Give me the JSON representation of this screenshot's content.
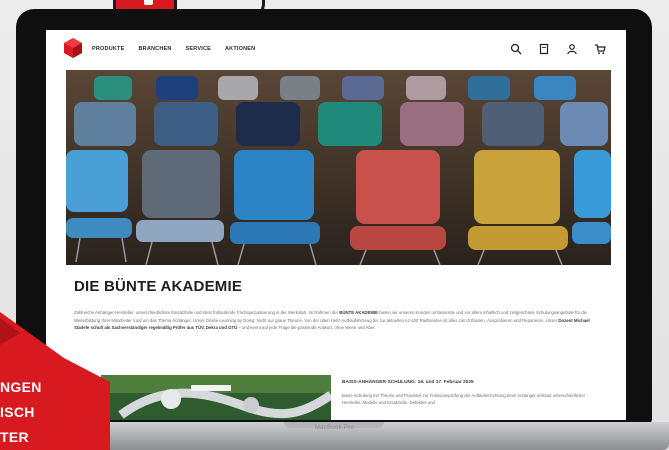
{
  "site": {
    "nav": [
      "PRODUKTE",
      "BRANCHEN",
      "SERVICE",
      "AKTIONEN"
    ]
  },
  "headline": "DIE BÜNTE AKADEMIE",
  "intro": {
    "part1": "Zahlreiche Anhänger-Hersteller, unterschiedlichste Einsatzfelle und stets fortlaufende Fachspezialisierung in der Werkstatt. Im Rahmen der ",
    "bold1": "BÜNTE AKADEMIE",
    "part2": " bieten wir unseren Kunden umfassende und vor allem inhaltlich und zielgerichtete Schulungsangebote für die Weiterbildung Ihrer Mitarbeiter rund um das Thema Anhänger. Unser Onsite-Learning by Doing: Nicht nur graue Theorie, Von der alten Heliz Aufbaufahrzeug bis zur aktuellen Az-400 Radbremse ist alles zum Erfassen, Ausprobieren und Reparieren. Unser ",
    "bold2": "Dozent Michael Stadele",
    "part3": " ",
    "bold3": "schult als Sachverständiger regelmäßig Prüfer aus TÜV, Dekra und GTÜ",
    "part4": " – und kennt auf jede Frage die passende Antwort, ohne Wenn und Aber."
  },
  "side": {
    "title": "BASIS-ANHÄNGER-SCHULUNG: 16. und 17. Februar 2025",
    "text": "Basis-Schulung mit Theorie und Praxisteil zur Funktionsprüfung der Auflaufeinrichtung beim Anhänger anhand unterschiedlicher Hersteller, Modelle und Ersatzteile. Defektes und"
  },
  "laptop": {
    "label": "MacBook Pro"
  },
  "ribbon": {
    "line1": "NGEN",
    "line2": "ISCH",
    "line3": "TER"
  },
  "colors": {
    "brand_red": "#d71920",
    "headline": "#1f1f1f"
  }
}
